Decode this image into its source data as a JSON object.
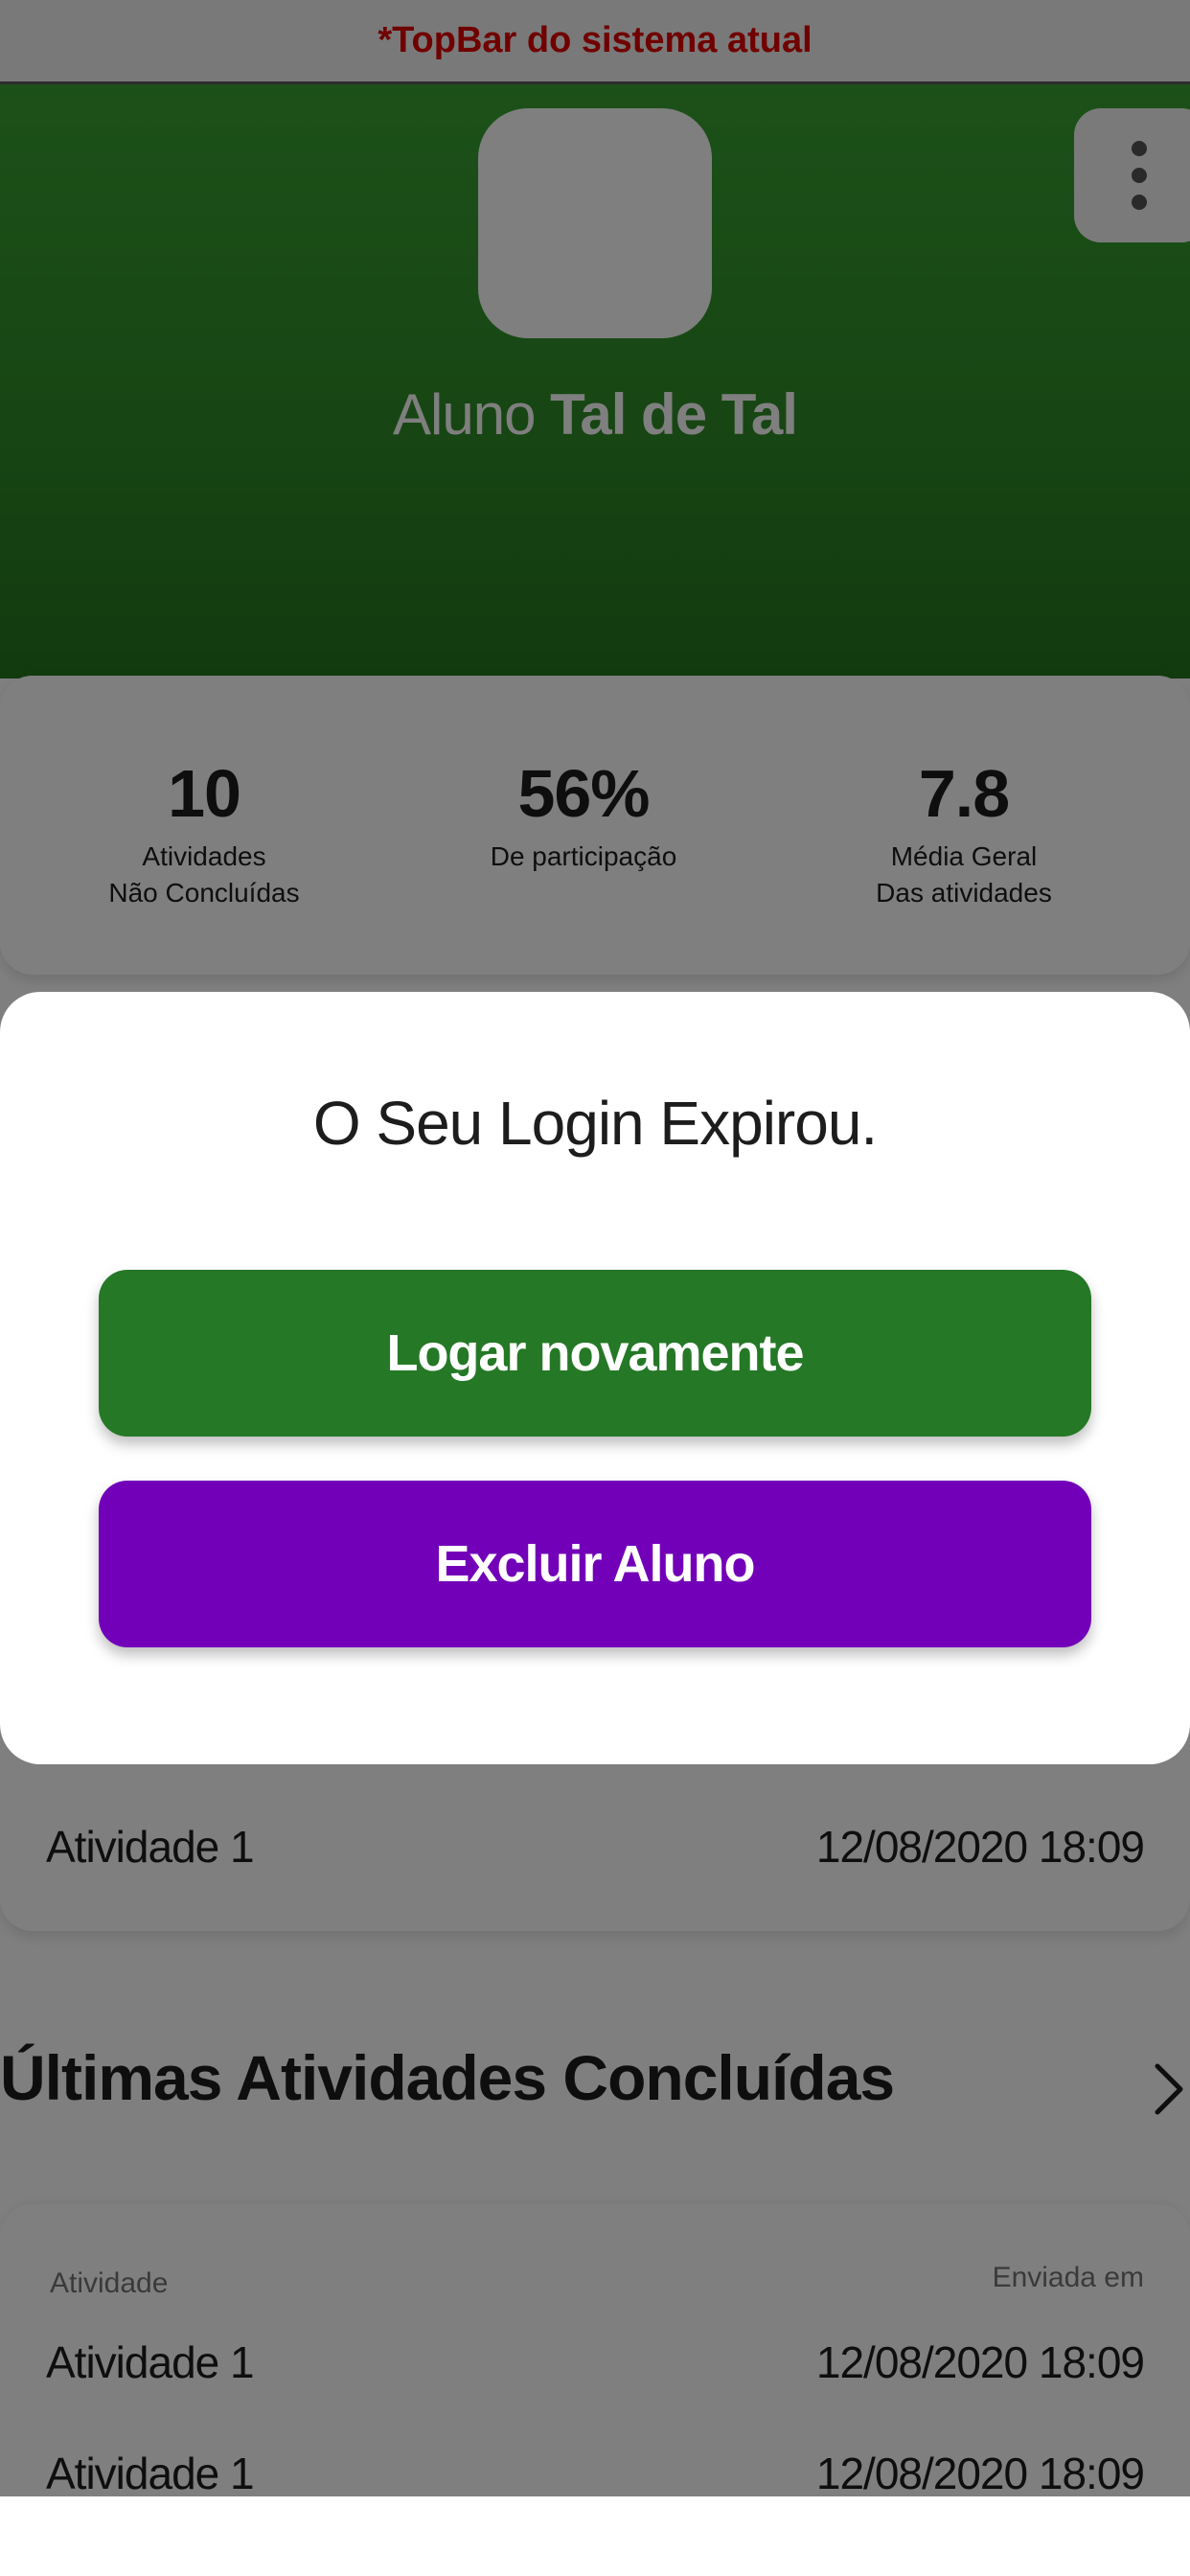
{
  "topbar": {
    "text": "*TopBar do sistema atual"
  },
  "profile": {
    "name_prefix": "Aluno",
    "name_bold": "Tal de Tal"
  },
  "menu": {
    "icon": "more-vertical-icon"
  },
  "stats": [
    {
      "value": "10",
      "label_line1": "Atividades",
      "label_line2": "Não Concluídas"
    },
    {
      "value": "56%",
      "label_line1": "De participação",
      "label_line2": ""
    },
    {
      "value": "7.8",
      "label_line1": "Média Geral",
      "label_line2": "Das atividades"
    }
  ],
  "pending": {
    "rows": [
      {
        "activity": "Atividade 1",
        "date": "12/08/2020 18:09"
      }
    ]
  },
  "completed": {
    "title": "Últimas Atividades Concluídas",
    "chevron_icon": "chevron-right-icon",
    "col_activity": "Atividade",
    "col_sent": "Enviada em",
    "rows": [
      {
        "activity": "Atividade 1",
        "date": "12/08/2020 18:09"
      },
      {
        "activity": "Atividade 1",
        "date": "12/08/2020 18:09"
      }
    ]
  },
  "modal": {
    "title": "O Seu Login Expirou.",
    "login_button": "Logar novamente",
    "delete_button": "Excluir Aluno"
  },
  "colors": {
    "brand_green": "#257826",
    "header_green": "#39a232",
    "delete_purple": "#7200b8",
    "topbar_red": "#e10000"
  }
}
